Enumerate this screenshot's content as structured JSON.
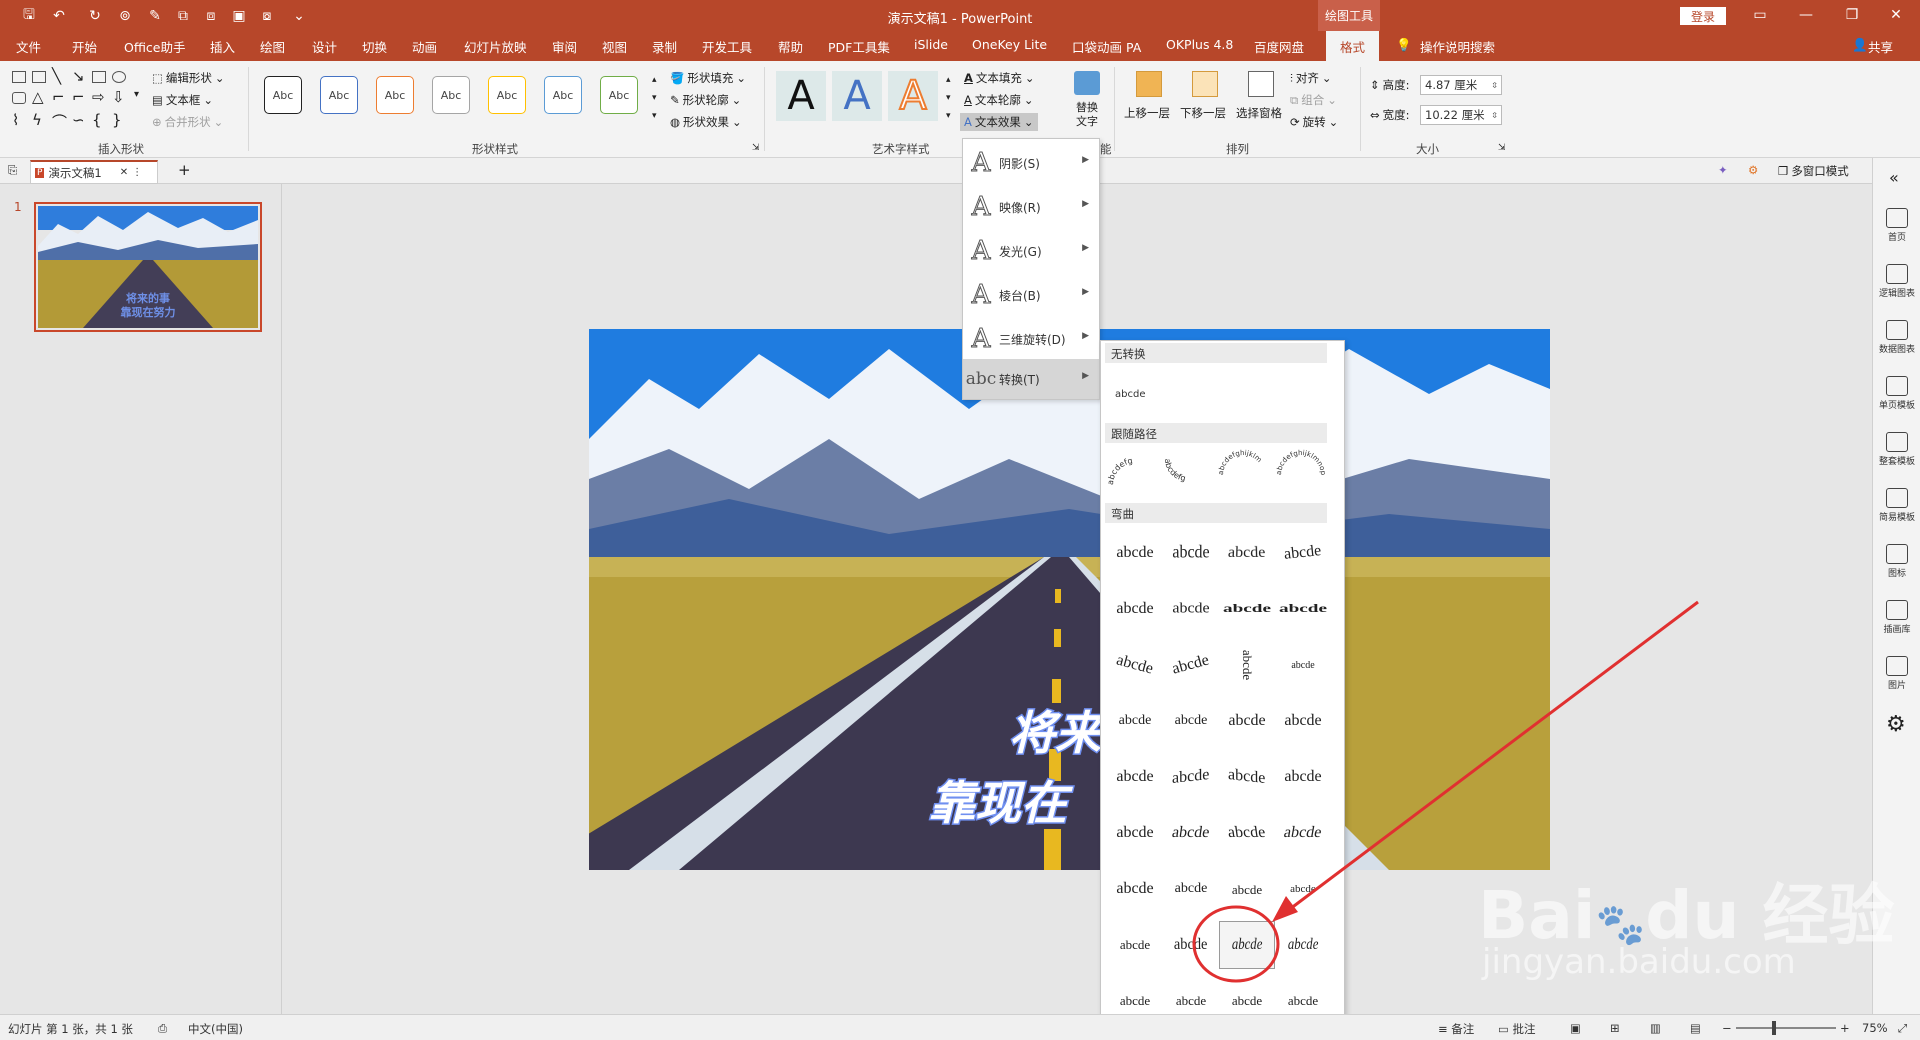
{
  "app": {
    "doc_title": "演示文稿1 - PowerPoint",
    "context_label": "绘图工具",
    "login": "登录"
  },
  "tabs": [
    "文件",
    "开始",
    "Office助手",
    "插入",
    "绘图",
    "设计",
    "切换",
    "动画",
    "幻灯片放映",
    "审阅",
    "视图",
    "录制",
    "开发工具",
    "帮助",
    "PDF工具集",
    "iSlide",
    "OneKey Lite",
    "口袋动画 PA",
    "OKPlus 4.8",
    "百度网盘",
    "格式"
  ],
  "search_hint": "操作说明搜索",
  "share": "共享",
  "ribbon": {
    "insert_shapes": {
      "label": "插入形状",
      "edit_shape": "编辑形状",
      "text_box": "文本框",
      "merge_shapes": "合并形状"
    },
    "shape_styles": {
      "label": "形状样式",
      "sample": "Abc",
      "fill": "形状填充",
      "outline": "形状轮廓",
      "effects": "形状效果"
    },
    "wordart": {
      "label": "艺术字样式",
      "letter": "A",
      "text_fill": "文本填充",
      "text_outline": "文本轮廓",
      "text_effects": "文本效果"
    },
    "replace_text": {
      "line1": "替换",
      "line2": "文字",
      "suffix": "能"
    },
    "arrange": {
      "label": "排列",
      "bring_forward": "上移一层",
      "send_backward": "下移一层",
      "selection_pane": "选择窗格",
      "align": "对齐",
      "group": "组合",
      "rotate": "旋转"
    },
    "size": {
      "label": "大小",
      "height_label": "高度:",
      "height_value": "4.87 厘米",
      "width_label": "宽度:",
      "width_value": "10.22 厘米"
    }
  },
  "doc_tab": {
    "name": "演示文稿1",
    "close": "✕",
    "add": "+",
    "multi_window": "多窗口模式"
  },
  "slide": {
    "number": "1",
    "text_line1": "将来的事",
    "text_line2": "靠现在努力",
    "canvas_line1": "将来的",
    "canvas_line2": "靠现在"
  },
  "effects_menu": [
    {
      "label": "阴影(S)"
    },
    {
      "label": "映像(R)"
    },
    {
      "label": "发光(G)"
    },
    {
      "label": "棱台(B)"
    },
    {
      "label": "三维旋转(D)"
    },
    {
      "label": "转换(T)",
      "selected": true
    }
  ],
  "transform_gallery": {
    "no_transform": "无转换",
    "no_transform_sample": "abcde",
    "follow_path": "跟随路径",
    "path_samples": [
      "abcdefg",
      "abcdefg",
      "abcdefghijklm",
      "abcdefghijklmnop"
    ],
    "warp": "弯曲",
    "warp_sample": "abcde",
    "warp_rows": 9,
    "more": "....."
  },
  "right_tools": [
    "首页",
    "逻辑图表",
    "数据图表",
    "单页模板",
    "整套模板",
    "简易模板",
    "图标",
    "插画库",
    "图片"
  ],
  "status": {
    "slide_info": "幻灯片 第 1 张，共 1 张",
    "language": "中文(中国)",
    "notes": "备注",
    "comments": "批注",
    "zoom": "75%",
    "zoom_minus": "−",
    "zoom_plus": "+"
  },
  "watermark": {
    "brand": "Bai",
    "brand2": "du",
    "cn": "经验",
    "url": "jingyan.baidu.com"
  },
  "colors": {
    "accent": "#b7472a",
    "annotation": "#e03030"
  }
}
